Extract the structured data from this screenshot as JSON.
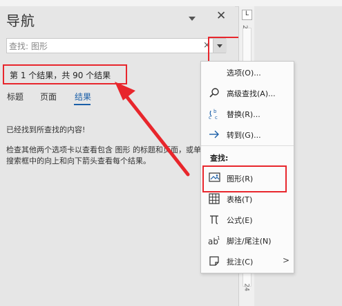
{
  "pane": {
    "title": "导航",
    "close_label": "✕",
    "search": {
      "value": "查找: 图形",
      "clear_label": "×"
    },
    "result_summary": "第 1 个结果，共 90 个结果",
    "tabs": [
      {
        "label": "标题",
        "active": false
      },
      {
        "label": "页面",
        "active": false
      },
      {
        "label": "结果",
        "active": true
      }
    ],
    "message_done": "已经找到所查找的内容!",
    "message_hint": "检查其他两个选项卡以查看包含 图形 的标题和页面，或单击搜索框中的向上和向下箭头查看每个结果。"
  },
  "ruler": {
    "corner_label": "L",
    "top_number": "2",
    "bottom_number": "24"
  },
  "menu": {
    "items": [
      {
        "label": "选项(O)...",
        "icon": "none"
      },
      {
        "label": "高级查找(A)...",
        "icon": "search-icon"
      },
      {
        "label": "替换(R)...",
        "icon": "replace-icon"
      },
      {
        "label": "转到(G)...",
        "icon": "arrow-right-icon"
      }
    ],
    "find_header": "查找:",
    "find_items": [
      {
        "label": "图形(R)",
        "icon": "graphic-icon"
      },
      {
        "label": "表格(T)",
        "icon": "table-icon"
      },
      {
        "label": "公式(E)",
        "icon": "equation-icon"
      },
      {
        "label": "脚注/尾注(N)",
        "icon": "footnote-icon"
      },
      {
        "label": "批注(C)",
        "icon": "comment-icon",
        "submenu_arrow": ">"
      }
    ]
  },
  "annotation_color": "#e8262c",
  "accent_color": "#1a5fa8"
}
